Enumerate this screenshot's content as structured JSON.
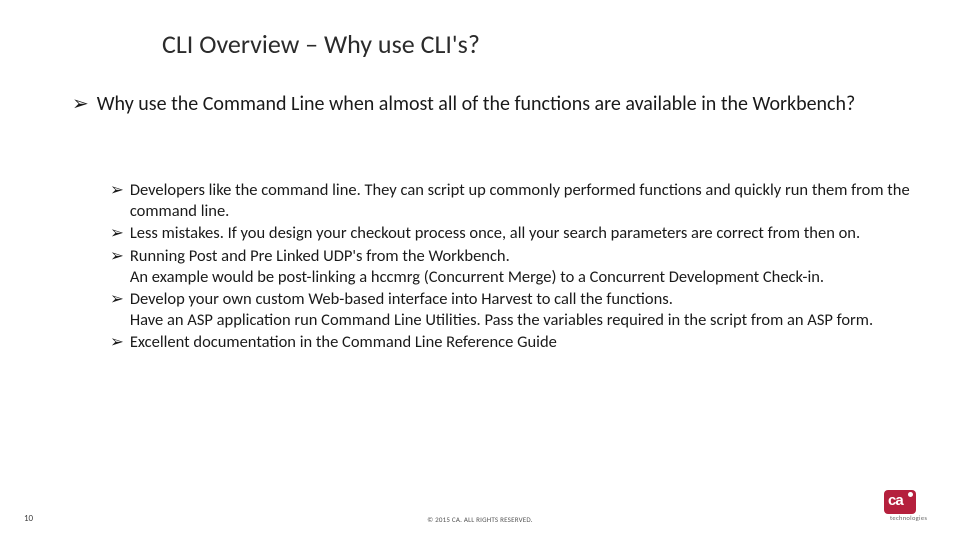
{
  "title": "CLI Overview – Why use CLI's?",
  "bullet_glyph": "➢",
  "main_bullet": "Why use the Command Line when almost all of the functions are available in the Workbench?",
  "sub_bullets": [
    "Developers like the command line.  They can script up commonly performed functions and quickly run them from the command line.",
    "Less mistakes.  If you design your checkout process once, all your search parameters are correct from then on.",
    "Running Post and Pre Linked UDP's from the Workbench.\nAn example would be post-linking a hccmrg (Concurrent Merge) to a Concurrent Development Check-in.",
    "Develop your own custom Web-based interface into Harvest to call the functions.\nHave an ASP application run Command Line Utilities.  Pass the variables required in the script from an ASP form.",
    "Excellent documentation in the Command Line Reference Guide"
  ],
  "footer": {
    "page_number": "10",
    "copyright": "© 2015 CA. ALL RIGHTS RESERVED.",
    "logo_text": "ca",
    "logo_sub": "technologies"
  }
}
